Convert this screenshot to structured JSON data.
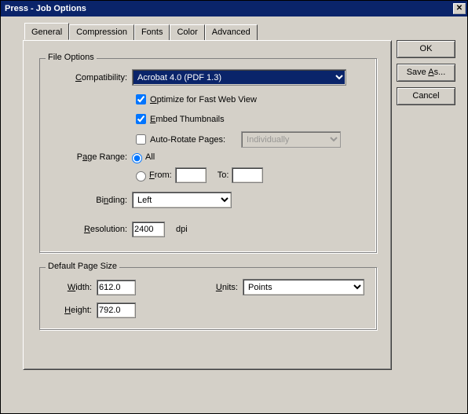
{
  "window": {
    "title": "Press - Job Options"
  },
  "tabs": {
    "general": "General",
    "compression": "Compression",
    "fonts": "Fonts",
    "color": "Color",
    "advanced": "Advanced"
  },
  "file_options": {
    "legend": "File Options",
    "compatibility_label": "Compatibility:",
    "compatibility_value": "Acrobat 4.0 (PDF 1.3)",
    "optimize_label": "Optimize for Fast Web View",
    "embed_label": "Embed Thumbnails",
    "autorotate_label": "Auto-Rotate Pages:",
    "autorotate_value": "Individually",
    "page_range_label": "Page Range:",
    "all_label": "All",
    "from_label": "From:",
    "to_label": "To:",
    "binding_label": "Binding:",
    "binding_value": "Left",
    "resolution_label": "Resolution:",
    "resolution_value": "2400",
    "dpi_label": "dpi"
  },
  "default_page_size": {
    "legend": "Default Page Size",
    "width_label": "Width:",
    "width_value": "612.0",
    "units_label": "Units:",
    "units_value": "Points",
    "height_label": "Height:",
    "height_value": "792.0"
  },
  "buttons": {
    "ok": "OK",
    "save_as": "Save As...",
    "cancel": "Cancel"
  }
}
